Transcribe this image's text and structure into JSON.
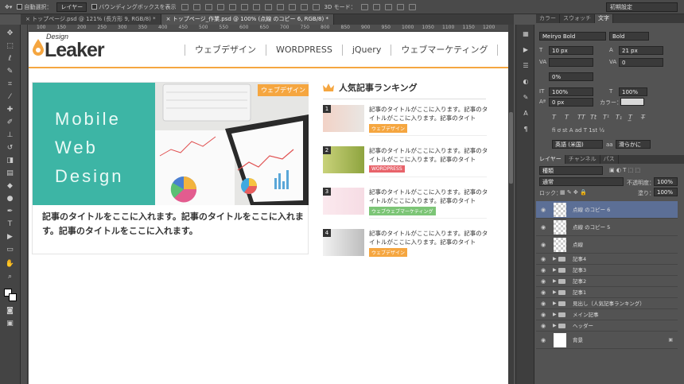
{
  "optbar": {
    "auto_select": "自動選択：",
    "layer_select": "レイヤー",
    "bbox": "バウンディングボックスを表示",
    "mode_3d": "3D モード：",
    "workspace": "初期設定"
  },
  "tabs": [
    {
      "label": "トップページ.psd @ 121% (長方形 9, RGB/8) *",
      "active": false
    },
    {
      "label": "トップページ_作業.psd @ 100% (点線 のコピー 6, RGB/8) *",
      "active": true
    }
  ],
  "ruler_ticks": [
    "100",
    "150",
    "200",
    "250",
    "300",
    "350",
    "400",
    "450",
    "500",
    "550",
    "600",
    "650",
    "700",
    "750",
    "800",
    "850",
    "900",
    "950",
    "1000",
    "1050",
    "1100",
    "1150",
    "1200"
  ],
  "site": {
    "logo_design": "Design",
    "logo_leaker": "Leaker",
    "nav": [
      "ウェブデザイン",
      "WORDPRESS",
      "jQuery",
      "ウェブマーケティング"
    ],
    "hero": {
      "words": [
        "Mobile",
        "Web",
        "Design"
      ],
      "badge": "ウェブデザイン",
      "title": "記事のタイトルをここに入れます。記事のタイトルをここに入れます。記事のタイトルをここに入れます。"
    },
    "ranking": {
      "heading": "人気記事ランキング",
      "items": [
        {
          "num": "1",
          "text": "記事のタイトルがここに入ります。記事のタイトルがここに入ります。記事のタイト",
          "tag": "ウェブデザイン",
          "tag_color": "#f5a640"
        },
        {
          "num": "2",
          "text": "記事のタイトルがここに入ります。記事のタイトルがここに入ります。記事のタイト",
          "tag": "WORDPRESS",
          "tag_color": "#e8636a"
        },
        {
          "num": "3",
          "text": "記事のタイトルがここに入ります。記事のタイトルがここに入ります。記事のタイト",
          "tag": "ウェブウェブマーケティング",
          "tag_color": "#7cc576"
        },
        {
          "num": "4",
          "text": "記事のタイトルがここに入ります。記事のタイトルがここに入ります。記事のタイト",
          "tag": "ウェブデザイン",
          "tag_color": "#f5a640"
        }
      ]
    }
  },
  "char_panel": {
    "tabs": [
      "カラー",
      "スウォッチ",
      "文字"
    ],
    "font": "Meiryo Bold",
    "style": "Bold",
    "size": "10 px",
    "leading": "21 px",
    "kerning": "",
    "tracking": "0",
    "tsume": "0%",
    "vscale": "100%",
    "hscale": "100%",
    "baseline": "0 px",
    "color_label": "カラー：",
    "language": "英語 (米国)",
    "aa": "滑らかに"
  },
  "layers_panel": {
    "tabs": [
      "レイヤー",
      "チャンネル",
      "パス"
    ],
    "kind": "種類",
    "blend": "通常",
    "opacity_label": "不透明度：",
    "opacity": "100%",
    "lock_label": "ロック：",
    "fill_label": "塗り：",
    "fill": "100%",
    "layers": [
      {
        "name": "点線 のコピー 6",
        "type": "layer",
        "selected": true
      },
      {
        "name": "点線 のコピー 5",
        "type": "layer",
        "selected": false
      },
      {
        "name": "点線",
        "type": "layer",
        "selected": false
      },
      {
        "name": "記事4",
        "type": "group",
        "selected": false
      },
      {
        "name": "記事3",
        "type": "group",
        "selected": false
      },
      {
        "name": "記事2",
        "type": "group",
        "selected": false
      },
      {
        "name": "記事1",
        "type": "group",
        "selected": false
      },
      {
        "name": "見出し（人気記事ランキング）",
        "type": "group",
        "selected": false
      },
      {
        "name": "メイン記事",
        "type": "group",
        "selected": false
      },
      {
        "name": "ヘッダー",
        "type": "group",
        "selected": false
      },
      {
        "name": "背景",
        "type": "bg",
        "selected": false
      }
    ]
  }
}
